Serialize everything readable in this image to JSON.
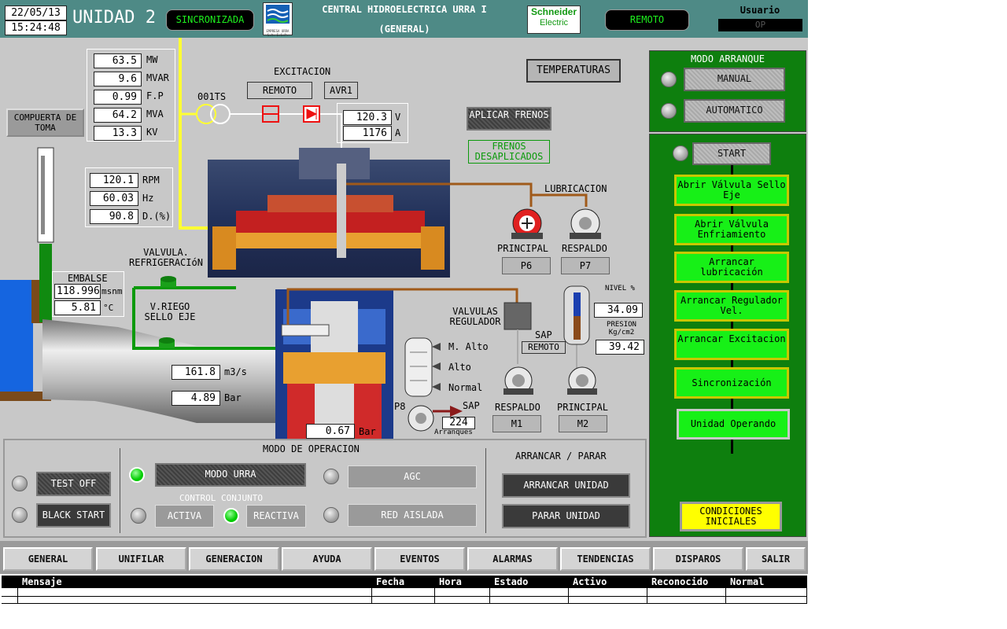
{
  "header": {
    "date": "22/05/13",
    "time": "15:24:48",
    "unit": "UNIDAD 2",
    "sync_status": "SINCRONIZADA",
    "title_line1": "CENTRAL HIDROELECTRICA URRA I",
    "title_line2": "(GENERAL)",
    "brand_line1": "Schneider",
    "brand_line2": "Electric",
    "logo_caption": "EMPRESA URRA S.A. E.S.P.",
    "control": "REMOTO",
    "user_label": "Usuario",
    "user_value": "OP"
  },
  "electrical": {
    "mw": "63.5",
    "mw_unit": "MW",
    "mvar": "9.6",
    "mvar_unit": "MVAR",
    "fp": "0.99",
    "fp_unit": "F.P",
    "mva": "64.2",
    "mva_unit": "MVA",
    "kv": "13.3",
    "kv_unit": "KV"
  },
  "speed": {
    "rpm": "120.1",
    "rpm_unit": "RPM",
    "hz": "60.03",
    "hz_unit": "Hz",
    "d": "90.8",
    "d_unit": "D.(%)"
  },
  "compuerta": "COMPUERTA DE TOMA",
  "transformer": "001TS",
  "excitation": {
    "title": "EXCITACION",
    "mode": "REMOTO",
    "avr": "AVR1",
    "voltage": "120.3",
    "voltage_unit": "V",
    "current": "1176",
    "current_unit": "A"
  },
  "temperatures_button": "TEMPERATURAS",
  "brakes": {
    "apply": "APLICAR FRENOS",
    "status": "FRENOS DESAPLICADOS"
  },
  "lubrication": {
    "title": "LUBRICACION",
    "principal": "PRINCIPAL",
    "respaldo": "RESPALDO",
    "p6": "P6",
    "p7": "P7"
  },
  "embalse": {
    "title": "EMBALSE",
    "level": "118.996",
    "level_unit": "msnm",
    "temp": "5.81",
    "temp_unit": "°C"
  },
  "valves": {
    "refrigeracion": "VALVULA. REFRIGERACIóN",
    "riego": "V.RIEGO SELLO EJE",
    "regulador": "VALVULAS REGULADOR"
  },
  "flow": {
    "flow": "161.8",
    "flow_unit": "m3/s",
    "pressure": "4.89",
    "pressure_unit": "Bar"
  },
  "draft_pressure": "0.67",
  "draft_pressure_unit": "Bar",
  "sap": {
    "title": "SAP",
    "mode": "REMOTO",
    "nivel_label": "NIVEL %",
    "nivel": "34.09",
    "presion_label": "PRESION Kg/cm2",
    "presion": "39.42",
    "m_alto": "M. Alto",
    "alto": "Alto",
    "normal": "Normal",
    "p8": "P8",
    "sap_arrow": "SAP",
    "arranques": "224",
    "arranques_label": "Arranques",
    "respaldo": "RESPALDO",
    "principal": "PRINCIPAL",
    "m1": "M1",
    "m2": "M2"
  },
  "operation": {
    "title": "MODO DE OPERACION",
    "test_off": "TEST OFF",
    "black_start": "BLACK START",
    "modo_urra": "MODO URRA",
    "control_conjunto": "CONTROL CONJUNTO",
    "activa": "ACTIVA",
    "reactiva": "REACTIVA",
    "agc": "AGC",
    "red_aislada": "RED AISLADA",
    "arrancar_parar": "ARRANCAR / PARAR",
    "arrancar_unidad": "ARRANCAR UNIDAD",
    "parar_unidad": "PARAR UNIDAD"
  },
  "start_panel": {
    "title": "MODO ARRANQUE",
    "manual": "MANUAL",
    "automatico": "AUTOMATICO",
    "start": "START",
    "steps": [
      "Abrir Válvula Sello Eje",
      "Abrir Válvula Enfriamiento",
      "Arrancar lubricación",
      "Arrancar Regulador Vel.",
      "Arrancar Excitacion",
      "Sincronización",
      "Unidad Operando"
    ],
    "conditions": "CONDICIONES INICIALES"
  },
  "nav": [
    "GENERAL",
    "UNIFILAR",
    "GENERACION",
    "AYUDA",
    "EVENTOS",
    "ALARMAS",
    "TENDENCIAS",
    "DISPAROS",
    "SALIR"
  ],
  "alarm_table": {
    "columns": [
      "Mensaje",
      "Fecha",
      "Hora",
      "Estado",
      "Activo",
      "Reconocido",
      "Normal"
    ]
  },
  "colors": {
    "header": "#4e8a86",
    "panel": "#c8c8c8",
    "start_panel": "#0e7f0e",
    "step_active": "#17f017",
    "yellow_line": "#ffff33"
  }
}
